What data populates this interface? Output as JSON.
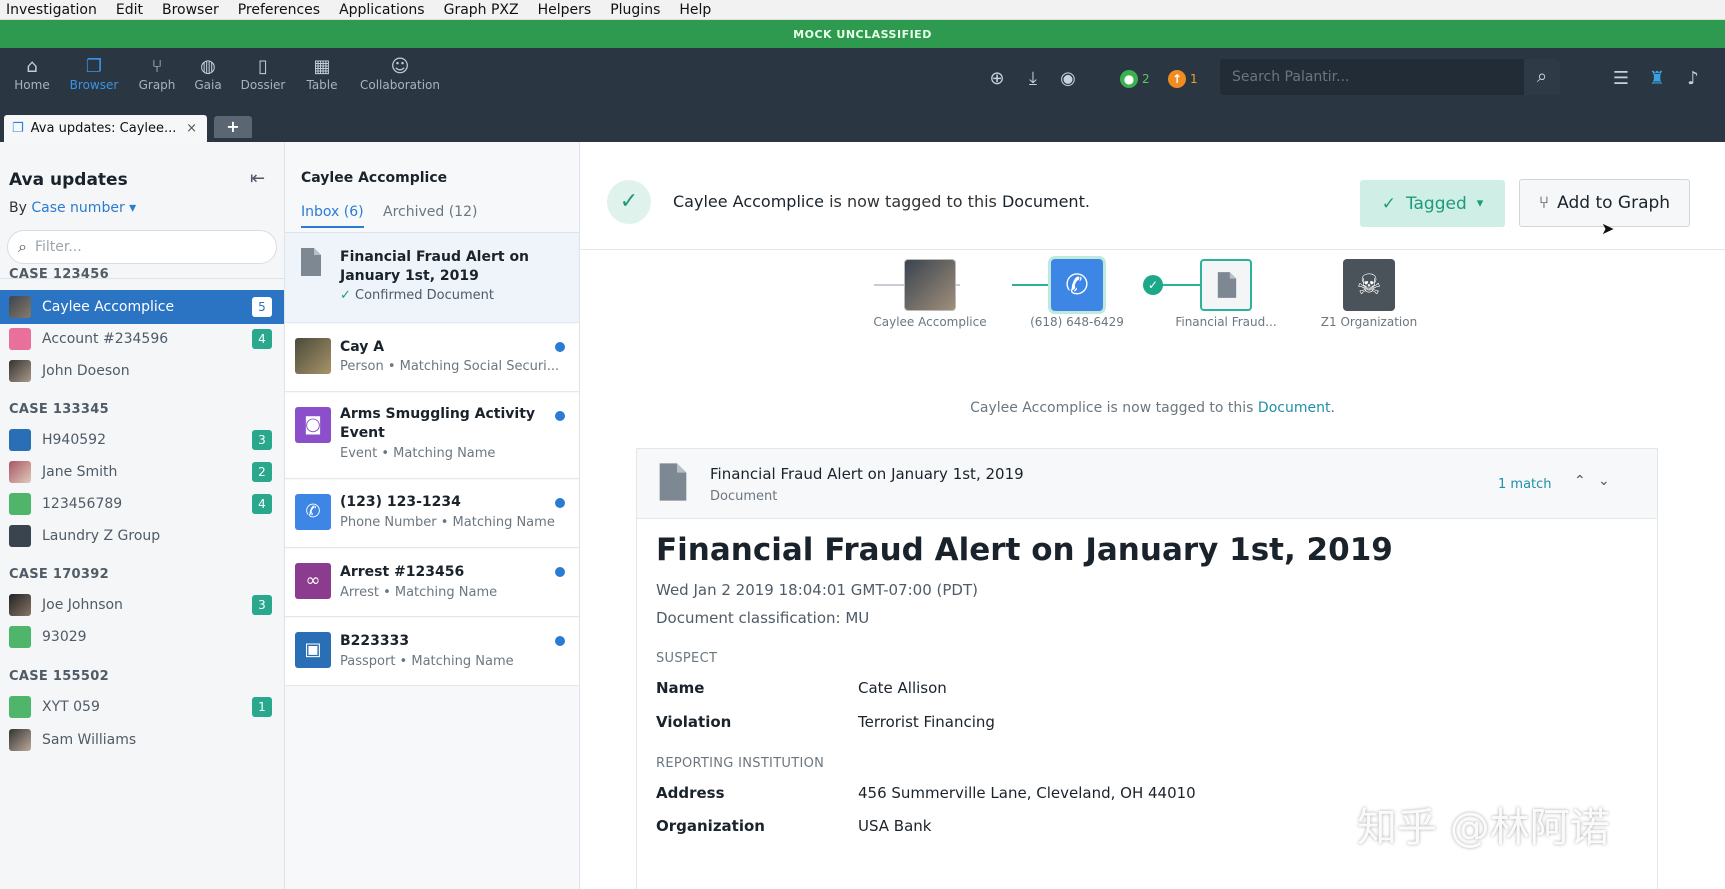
{
  "menu": [
    "Investigation",
    "Edit",
    "Browser",
    "Preferences",
    "Applications",
    "Graph PXZ",
    "Helpers",
    "Plugins",
    "Help"
  ],
  "banner": "MOCK UNCLASSIFIED",
  "nav": {
    "home": "Home",
    "browser": "Browser",
    "graph": "Graph",
    "gaia": "Gaia",
    "dossier": "Dossier",
    "table": "Table",
    "collaboration": "Collaboration"
  },
  "header": {
    "green_count": "2",
    "orange_count": "1",
    "search_placeholder": "Search Palantir..."
  },
  "tab": {
    "label": "Ava updates: Caylee...",
    "close": "×",
    "add": "+"
  },
  "sidebar": {
    "title": "Ava updates",
    "by_label": "By",
    "by_value": "Case number",
    "filter_placeholder": "Filter...",
    "cases": [
      {
        "header": "CASE 123456",
        "items": [
          {
            "label": "Caylee Accomplice",
            "count": "5"
          },
          {
            "label": "Account #234596",
            "count": "4"
          },
          {
            "label": "John Doeson",
            "count": ""
          }
        ]
      },
      {
        "header": "CASE 133345",
        "items": [
          {
            "label": "H940592",
            "count": "3"
          },
          {
            "label": "Jane Smith",
            "count": "2"
          },
          {
            "label": "123456789",
            "count": "4"
          },
          {
            "label": "Laundry Z Group",
            "count": ""
          }
        ]
      },
      {
        "header": "CASE 170392",
        "items": [
          {
            "label": "Joe Johnson",
            "count": "3"
          },
          {
            "label": "93029",
            "count": ""
          }
        ]
      },
      {
        "header": "CASE 155502",
        "items": [
          {
            "label": "XYT 059",
            "count": "1"
          },
          {
            "label": "Sam Williams",
            "count": ""
          }
        ]
      }
    ]
  },
  "inbox": {
    "title": "Caylee Accomplice",
    "tab_inbox": "Inbox (6)",
    "tab_archived": "Archived (12)",
    "items": [
      {
        "title": "Financial Fraud Alert on January 1st, 2019",
        "subtitle": "Confirmed Document"
      },
      {
        "title": "Cay A",
        "subtitle": "Person • Matching Social Securi..."
      },
      {
        "title": "Arms Smuggling Activity Event",
        "subtitle": "Event • Matching Name"
      },
      {
        "title": "(123) 123-1234",
        "subtitle": "Phone Number • Matching Name"
      },
      {
        "title": "Arrest #123456",
        "subtitle": "Arrest • Matching Name"
      },
      {
        "title": "B223333",
        "subtitle": "Passport • Matching Name"
      }
    ]
  },
  "main": {
    "tag_entity": "Caylee Accomplice",
    "tag_mid": " is now tagged to this ",
    "tag_doc": "Document",
    "tag_end": ".",
    "tagged_button": "Tagged",
    "add_graph_button": "Add to Graph",
    "graph_nodes": [
      "Caylee Accomplice",
      "(618) 648-6429",
      "Financial Fraud...",
      "Z1 Organization"
    ],
    "graph_msg_a": "Caylee Accomplice is now tagged to this ",
    "graph_msg_link": "Document",
    "graph_msg_end": "."
  },
  "card": {
    "head_title": "Financial Fraud Alert on January 1st, 2019",
    "head_sub": "Document",
    "match": "1 match",
    "doc_title": "Financial Fraud Alert on January 1st, 2019",
    "date": "Wed Jan 2 2019 18:04:01 GMT-07:00 (PDT)",
    "classification": "Document classification: MU",
    "suspect_header": "SUSPECT",
    "name_key": "Name",
    "name_val": "Cate Allison",
    "violation_key": "Violation",
    "violation_val": "Terrorist Financing",
    "inst_header": "REPORTING INSTITUTION",
    "address_key": "Address",
    "address_val": "456 Summerville Lane, Cleveland, OH 44010",
    "org_key": "Organization",
    "org_val": "USA Bank"
  },
  "watermark": "知乎 @林阿诺",
  "colors": {
    "banner": "#2e9a4f",
    "header_bg": "#2a3642",
    "accent_blue": "#2b7bd3",
    "teal": "#1e9a7a",
    "count_badge": "#29a88e"
  }
}
